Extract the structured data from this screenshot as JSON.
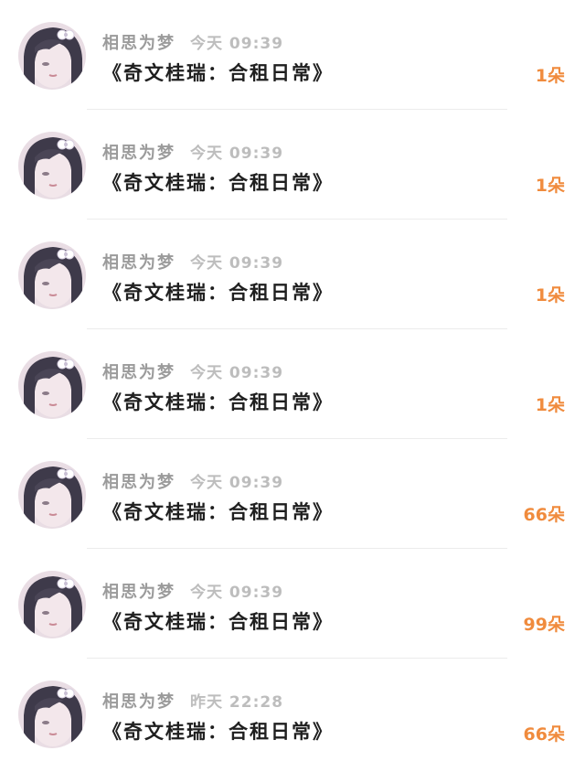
{
  "list": {
    "items": [
      {
        "name": "相思为梦",
        "time": "今天 09:39",
        "title": "《奇文桂瑞：合租日常》",
        "amount": "1朵"
      },
      {
        "name": "相思为梦",
        "time": "今天 09:39",
        "title": "《奇文桂瑞：合租日常》",
        "amount": "1朵"
      },
      {
        "name": "相思为梦",
        "time": "今天 09:39",
        "title": "《奇文桂瑞：合租日常》",
        "amount": "1朵"
      },
      {
        "name": "相思为梦",
        "time": "今天 09:39",
        "title": "《奇文桂瑞：合租日常》",
        "amount": "1朵"
      },
      {
        "name": "相思为梦",
        "time": "今天 09:39",
        "title": "《奇文桂瑞：合租日常》",
        "amount": "66朵"
      },
      {
        "name": "相思为梦",
        "time": "今天 09:39",
        "title": "《奇文桂瑞：合租日常》",
        "amount": "99朵"
      },
      {
        "name": "相思为梦",
        "time": "昨天 22:28",
        "title": "《奇文桂瑞：合租日常》",
        "amount": "66朵"
      }
    ]
  },
  "colors": {
    "amount": "#f08b3d",
    "name": "#9b9b9b",
    "time": "#bdbdbd",
    "title": "#1f1f1f",
    "divider": "#ececec"
  },
  "icons": {
    "avatar": "user-avatar-photo"
  }
}
